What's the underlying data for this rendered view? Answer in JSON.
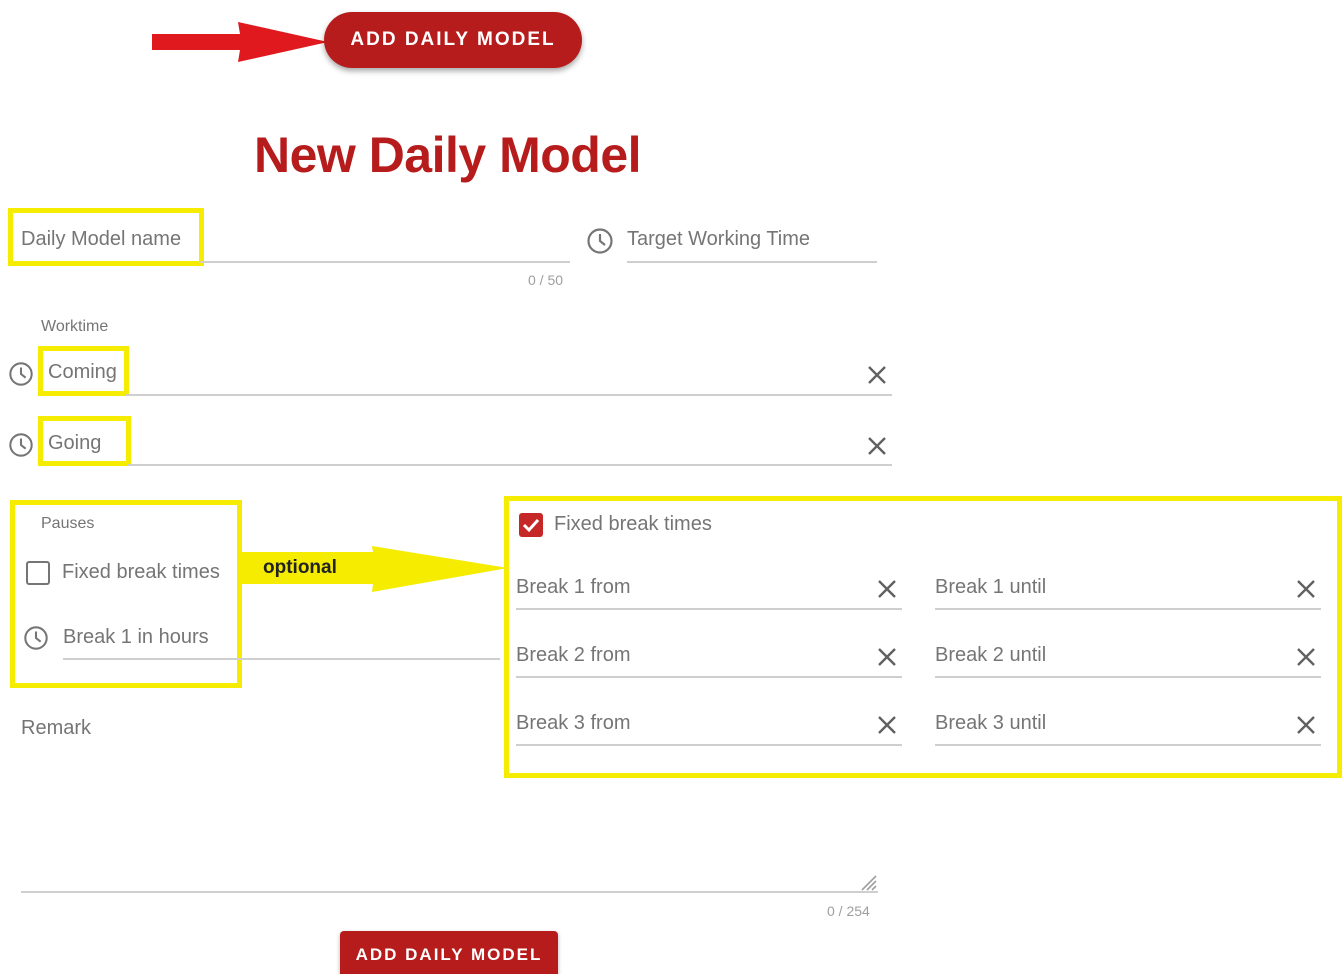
{
  "top_button": {
    "label": "ADD DAILY MODEL"
  },
  "title": "New Daily Model",
  "name_field": {
    "placeholder": "Daily Model name",
    "counter": "0 / 50"
  },
  "target_field": {
    "placeholder": "Target Working Time"
  },
  "worktime": {
    "label": "Worktime",
    "coming": "Coming",
    "going": "Going"
  },
  "pauses": {
    "label": "Pauses",
    "fixed_label": "Fixed break times",
    "break1_hours": "Break 1 in hours"
  },
  "optional_label": "optional",
  "fixed_panel": {
    "checkbox_label": "Fixed break times",
    "fields": [
      {
        "from": "Break 1 from",
        "until": "Break 1 until"
      },
      {
        "from": "Break 2 from",
        "until": "Break 2 until"
      },
      {
        "from": "Break 3 from",
        "until": "Break 3 until"
      }
    ]
  },
  "remark": {
    "label": "Remark",
    "counter": "0 / 254"
  },
  "bottom_button": {
    "label": "ADD DAILY MODEL"
  },
  "colors": {
    "accent": "#b71c1c",
    "highlight": "#f5ec00"
  },
  "icons": {
    "clock": "clock-icon",
    "clear": "close-icon",
    "check": "check-icon",
    "arrow": "arrow-right-icon"
  }
}
